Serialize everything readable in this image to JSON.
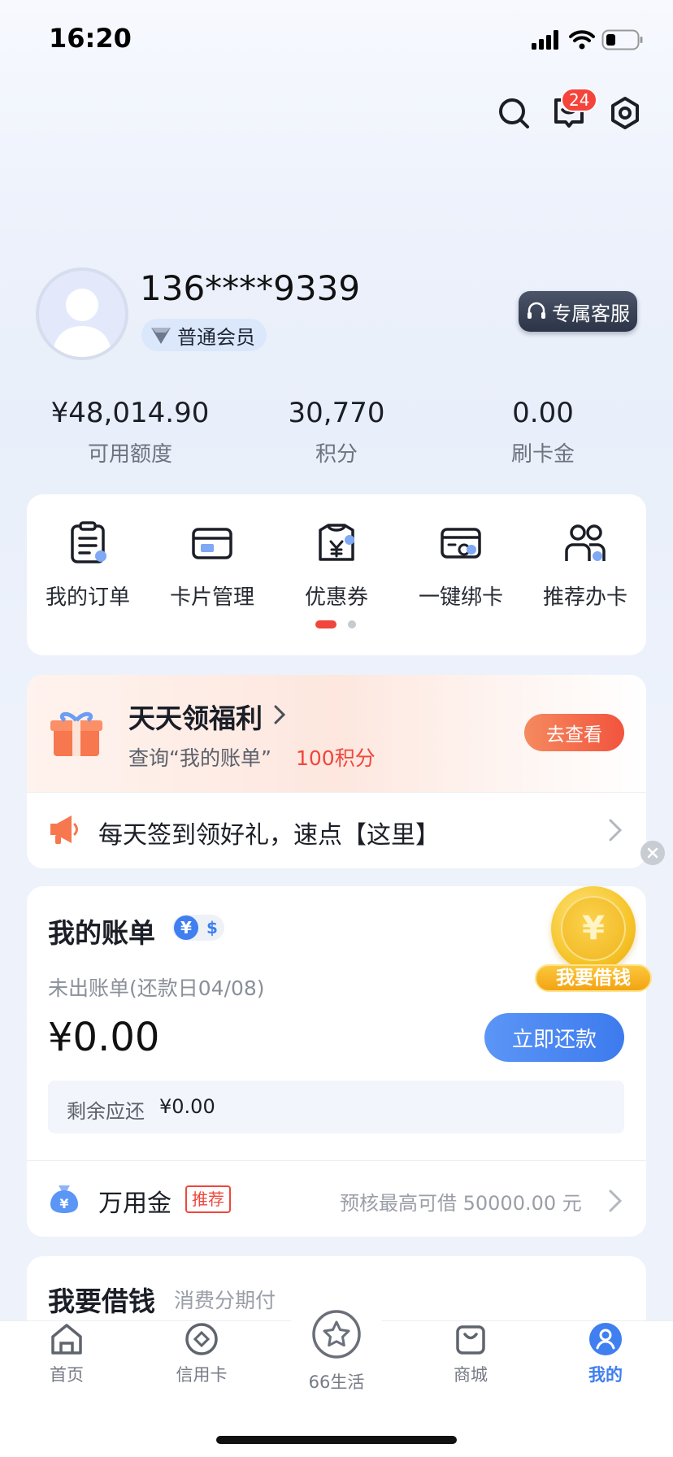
{
  "status": {
    "time": "16:20"
  },
  "header": {
    "messages_badge": "24"
  },
  "profile": {
    "phone": "136****9339",
    "level": "普通会员",
    "service_button": "专属客服"
  },
  "stats": [
    {
      "value": "¥48,014.90",
      "label": "可用额度"
    },
    {
      "value": "30,770",
      "label": "积分"
    },
    {
      "value": "0.00",
      "label": "刷卡金"
    }
  ],
  "shortcuts": [
    {
      "label": "我的订单",
      "icon": "orders-icon"
    },
    {
      "label": "卡片管理",
      "icon": "card-manage-icon"
    },
    {
      "label": "优惠券",
      "icon": "coupon-icon"
    },
    {
      "label": "一键绑卡",
      "icon": "bind-card-icon"
    },
    {
      "label": "推荐办卡",
      "icon": "refer-card-icon"
    }
  ],
  "shortcuts_page": {
    "current": 1,
    "total": 2
  },
  "welfare": {
    "title": "天天领福利",
    "desc": "查询“我的账单”",
    "points": "100积分",
    "button": "去查看",
    "signin_text": "每天签到领好礼，速点【这里】"
  },
  "bill": {
    "title": "我的账单",
    "status": "未出账单(还款日04/08)",
    "amount": "¥0.00",
    "repay_button": "立即还款",
    "remaining_label": "剩余应还",
    "remaining_value": "¥0.00",
    "currency_cny": "¥",
    "currency_usd": "$"
  },
  "loan_float": {
    "label": "我要借钱",
    "coin_symbol": "¥"
  },
  "wanyongjin": {
    "name": "万用金",
    "tag": "推荐",
    "desc": "预核最高可借 50000.00 元"
  },
  "loan_section": {
    "title": "我要借钱",
    "subtitle": "消费分期付"
  },
  "bottom_nav": [
    {
      "label": "首页"
    },
    {
      "label": "信用卡"
    },
    {
      "label": "66生活"
    },
    {
      "label": "商城"
    },
    {
      "label": "我的",
      "active": true
    }
  ],
  "colors": {
    "primary_blue": "#3f7ff0",
    "accent_red": "#f0463c",
    "orange": "#f5683d"
  }
}
